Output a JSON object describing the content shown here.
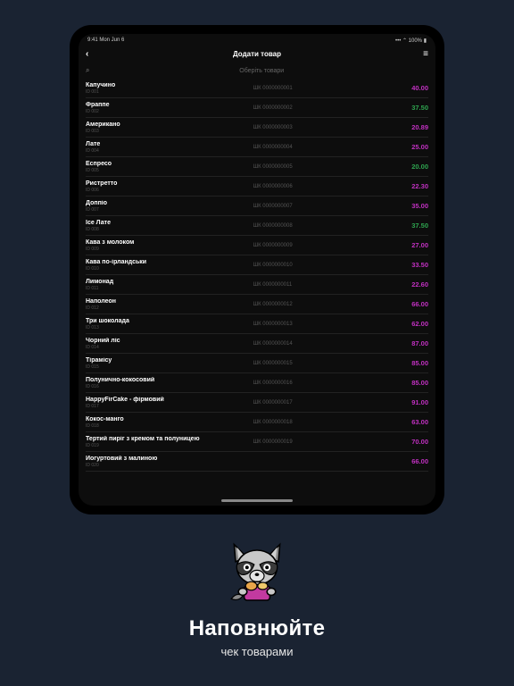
{
  "statusbar": {
    "time": "9:41  Mon Jun 6",
    "right": "100%"
  },
  "nav": {
    "title": "Додати товар"
  },
  "search": {
    "placeholder": "Оберіть товари"
  },
  "items": [
    {
      "name": "Капучино",
      "id": "ID 001",
      "code": "ШК 0000000001",
      "price": "40.00",
      "cls": ""
    },
    {
      "name": "Фраппе",
      "id": "ID 002",
      "code": "ШК 0000000002",
      "price": "37.50",
      "cls": "green"
    },
    {
      "name": "Американо",
      "id": "ID 003",
      "code": "ШК 0000000003",
      "price": "20.89",
      "cls": ""
    },
    {
      "name": "Лате",
      "id": "ID 004",
      "code": "ШК 0000000004",
      "price": "25.00",
      "cls": ""
    },
    {
      "name": "Еспресо",
      "id": "ID 005",
      "code": "ШК 0000000005",
      "price": "20.00",
      "cls": "green"
    },
    {
      "name": "Ристретто",
      "id": "ID 006",
      "code": "ШК 0000000006",
      "price": "22.30",
      "cls": ""
    },
    {
      "name": "Доппіо",
      "id": "ID 007",
      "code": "ШК 0000000007",
      "price": "35.00",
      "cls": ""
    },
    {
      "name": "Ice Лате",
      "id": "ID 008",
      "code": "ШК 0000000008",
      "price": "37.50",
      "cls": "green"
    },
    {
      "name": "Кава з молоком",
      "id": "ID 009",
      "code": "ШК 0000000009",
      "price": "27.00",
      "cls": ""
    },
    {
      "name": "Кава по-ірландськи",
      "id": "ID 010",
      "code": "ШК 0000000010",
      "price": "33.50",
      "cls": ""
    },
    {
      "name": "Лимонад",
      "id": "ID 011",
      "code": "ШК 0000000011",
      "price": "22.60",
      "cls": ""
    },
    {
      "name": "Наполеон",
      "id": "ID 012",
      "code": "ШК 0000000012",
      "price": "66.00",
      "cls": ""
    },
    {
      "name": "Три шоколада",
      "id": "ID 013",
      "code": "ШК 0000000013",
      "price": "62.00",
      "cls": ""
    },
    {
      "name": "Чорний ліс",
      "id": "ID 014",
      "code": "ШК 0000000014",
      "price": "87.00",
      "cls": ""
    },
    {
      "name": "Тірамісу",
      "id": "ID 015",
      "code": "ШК 0000000015",
      "price": "85.00",
      "cls": ""
    },
    {
      "name": "Полунично-кокосовий",
      "id": "ID 016",
      "code": "ШК 0000000016",
      "price": "85.00",
      "cls": ""
    },
    {
      "name": "HappyFirCake - фірмовий",
      "id": "ID 017",
      "code": "ШК 0000000017",
      "price": "91.00",
      "cls": ""
    },
    {
      "name": "Кокос-манго",
      "id": "ID 018",
      "code": "ШК 0000000018",
      "price": "63.00",
      "cls": ""
    },
    {
      "name": "Тертий пиріг з кремом та полуницею",
      "id": "ID 019",
      "code": "ШК 0000000019",
      "price": "70.00",
      "cls": ""
    },
    {
      "name": "Йогуртовий з малиною",
      "id": "ID 020",
      "code": "",
      "price": "66.00",
      "cls": ""
    }
  ],
  "caption": {
    "title": "Наповнюйте",
    "subtitle": "чек товарами"
  }
}
